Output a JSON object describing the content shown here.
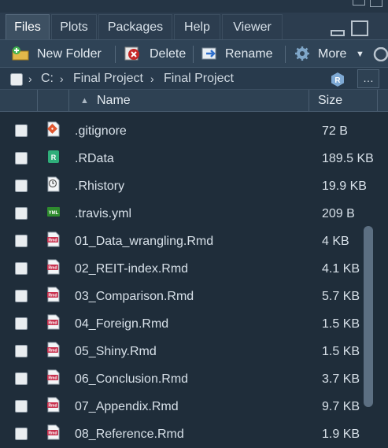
{
  "tabs": [
    {
      "label": "Files",
      "active": true
    },
    {
      "label": "Plots",
      "active": false
    },
    {
      "label": "Packages",
      "active": false
    },
    {
      "label": "Help",
      "active": false
    },
    {
      "label": "Viewer",
      "active": false
    }
  ],
  "toolbar": {
    "new_folder": "New Folder",
    "delete": "Delete",
    "rename": "Rename",
    "more": "More"
  },
  "path": {
    "root": "C:",
    "segments": [
      "Final Project",
      "Final Project"
    ]
  },
  "columns": {
    "name": "Name",
    "size": "Size",
    "sort": "ascending"
  },
  "files": [
    {
      "name": ".gitignore",
      "size": "72 B",
      "icon": "git-icon"
    },
    {
      "name": ".RData",
      "size": "189.5 KB",
      "icon": "rdata-icon"
    },
    {
      "name": ".Rhistory",
      "size": "19.9 KB",
      "icon": "history-icon"
    },
    {
      "name": ".travis.yml",
      "size": "209 B",
      "icon": "yml-icon"
    },
    {
      "name": "01_Data_wrangling.Rmd",
      "size": "4 KB",
      "icon": "rmd-icon"
    },
    {
      "name": "02_REIT-index.Rmd",
      "size": "4.1 KB",
      "icon": "rmd-icon"
    },
    {
      "name": "03_Comparison.Rmd",
      "size": "5.7 KB",
      "icon": "rmd-icon"
    },
    {
      "name": "04_Foreign.Rmd",
      "size": "1.5 KB",
      "icon": "rmd-icon"
    },
    {
      "name": "05_Shiny.Rmd",
      "size": "1.5 KB",
      "icon": "rmd-icon"
    },
    {
      "name": "06_Conclusion.Rmd",
      "size": "3.7 KB",
      "icon": "rmd-icon"
    },
    {
      "name": "07_Appendix.Rmd",
      "size": "9.7 KB",
      "icon": "rmd-icon"
    },
    {
      "name": "08_Reference.Rmd",
      "size": "1.9 KB",
      "icon": "rmd-icon"
    }
  ],
  "colors": {
    "background": "#1f2d3a",
    "rmd": "#c8324f",
    "rproj": "#6f9fd0"
  }
}
